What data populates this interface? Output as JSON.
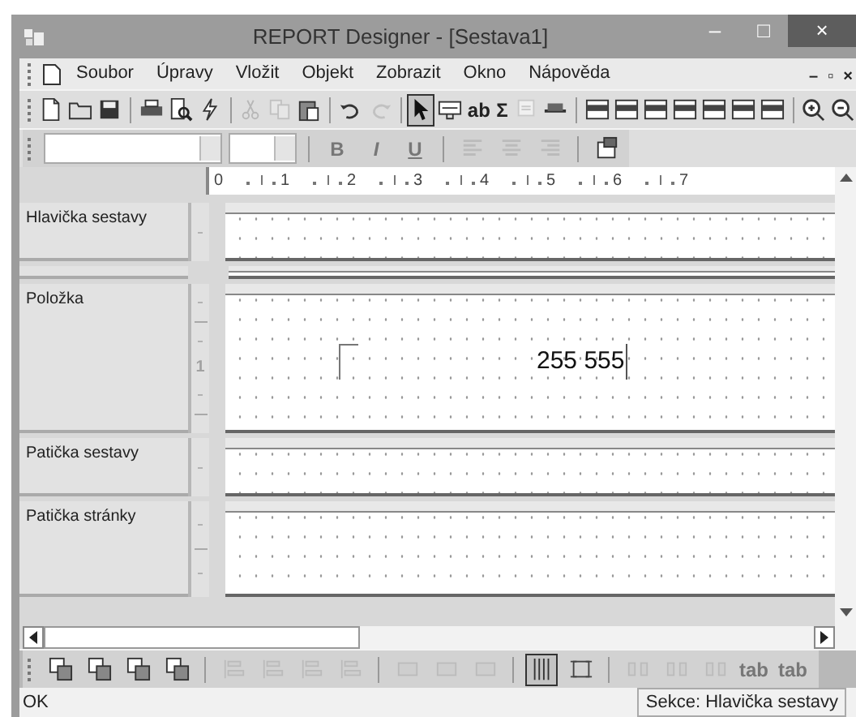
{
  "window": {
    "title": "REPORT Designer - [Sestava1]",
    "controls": [
      "–",
      "□",
      "×"
    ]
  },
  "menu": {
    "items": [
      "Soubor",
      "Úpravy",
      "Vložit",
      "Objekt",
      "Zobrazit",
      "Okno",
      "Nápověda"
    ],
    "mdi_controls": [
      "–",
      "▫",
      "×"
    ]
  },
  "toolbar_main": [
    {
      "kind": "doc",
      "disabled": false
    },
    {
      "kind": "folder",
      "disabled": false
    },
    {
      "kind": "disk",
      "disabled": false
    },
    {
      "kind": "sep"
    },
    {
      "kind": "printer",
      "disabled": false
    },
    {
      "kind": "preview",
      "disabled": false
    },
    {
      "kind": "bolt",
      "disabled": false
    },
    {
      "kind": "sep"
    },
    {
      "kind": "scissors",
      "disabled": true
    },
    {
      "kind": "copy",
      "disabled": true
    },
    {
      "kind": "paste",
      "disabled": false
    },
    {
      "kind": "sep"
    },
    {
      "kind": "undo",
      "disabled": false
    },
    {
      "kind": "redo",
      "disabled": true
    },
    {
      "kind": "sep"
    },
    {
      "kind": "pointer",
      "disabled": false,
      "selected": true
    },
    {
      "kind": "field",
      "disabled": false,
      "selected": false
    },
    {
      "kind": "label",
      "text": "ab",
      "disabled": false,
      "selected": false
    },
    {
      "kind": "label",
      "text": "Σ",
      "disabled": false,
      "selected": false
    },
    {
      "kind": "picture",
      "disabled": true,
      "selected": false
    },
    {
      "kind": "line",
      "disabled": false,
      "selected": false
    },
    {
      "kind": "sep"
    },
    {
      "kind": "band",
      "disabled": false
    },
    {
      "kind": "band",
      "disabled": false
    },
    {
      "kind": "band",
      "disabled": false
    },
    {
      "kind": "band",
      "disabled": false
    },
    {
      "kind": "band",
      "disabled": false
    },
    {
      "kind": "band",
      "disabled": false
    },
    {
      "kind": "band",
      "disabled": false
    },
    {
      "kind": "sep"
    },
    {
      "kind": "zoomin",
      "disabled": false
    },
    {
      "kind": "zoomout",
      "disabled": false
    }
  ],
  "toolbar_format": {
    "font_combo": {
      "disabled": false
    },
    "size_combo": {
      "disabled": false
    },
    "buttons": [
      {
        "kind": "sep"
      },
      {
        "kind": "bold",
        "text": "B",
        "disabled": true
      },
      {
        "kind": "italic",
        "text": "I",
        "disabled": true
      },
      {
        "kind": "underline",
        "text": "U",
        "disabled": true
      },
      {
        "kind": "sep"
      },
      {
        "kind": "alignleft",
        "disabled": true
      },
      {
        "kind": "aligncenter",
        "disabled": true
      },
      {
        "kind": "alignright",
        "disabled": true
      },
      {
        "kind": "sep"
      },
      {
        "kind": "props",
        "disabled": false
      }
    ]
  },
  "ruler": [
    "0",
    "1",
    "2",
    "3",
    "4",
    "5",
    "6",
    "7"
  ],
  "sections": [
    {
      "kind": "band",
      "name": "Hlavička sestavy",
      "marks": [
        {
          "kind": "dot"
        }
      ]
    },
    {
      "kind": "collapsed"
    },
    {
      "kind": "band",
      "name": "Položka",
      "marks": [
        {
          "kind": "dot"
        },
        {
          "kind": "line"
        },
        {
          "kind": "dot"
        },
        {
          "kind": "number",
          "label": "1"
        },
        {
          "kind": "dot"
        },
        {
          "kind": "line"
        }
      ],
      "objects": [
        {
          "kind": "frame"
        },
        {
          "kind": "field",
          "text": "255 555"
        }
      ]
    },
    {
      "kind": "band",
      "name": "Patička sestavy",
      "marks": [
        {
          "kind": "dot"
        }
      ]
    },
    {
      "kind": "band",
      "name": "Patička stránky",
      "marks": [
        {
          "kind": "dot"
        },
        {
          "kind": "line"
        },
        {
          "kind": "dot"
        }
      ]
    }
  ],
  "toolbar_layout": [
    {
      "kind": "layers",
      "disabled": false
    },
    {
      "kind": "layers",
      "disabled": false
    },
    {
      "kind": "layers",
      "disabled": false
    },
    {
      "kind": "layers",
      "disabled": false
    },
    {
      "kind": "sep"
    },
    {
      "kind": "align",
      "disabled": true
    },
    {
      "kind": "align",
      "disabled": true
    },
    {
      "kind": "align",
      "disabled": true
    },
    {
      "kind": "align",
      "disabled": true
    },
    {
      "kind": "sep"
    },
    {
      "kind": "size",
      "disabled": true
    },
    {
      "kind": "size",
      "disabled": true
    },
    {
      "kind": "size",
      "disabled": true
    },
    {
      "kind": "sep"
    },
    {
      "kind": "grid",
      "disabled": false,
      "selected": true
    },
    {
      "kind": "frame",
      "disabled": false,
      "selected": false
    },
    {
      "kind": "sep"
    },
    {
      "kind": "spacing",
      "disabled": true
    },
    {
      "kind": "spacing",
      "disabled": true
    },
    {
      "kind": "spacing",
      "disabled": true
    },
    {
      "kind": "label",
      "text": "tab",
      "disabled": true
    },
    {
      "kind": "label",
      "text": "tab",
      "disabled": true
    }
  ],
  "status_bar": {
    "message": "OK",
    "section": "Sekce: Hlavička sestavy"
  }
}
